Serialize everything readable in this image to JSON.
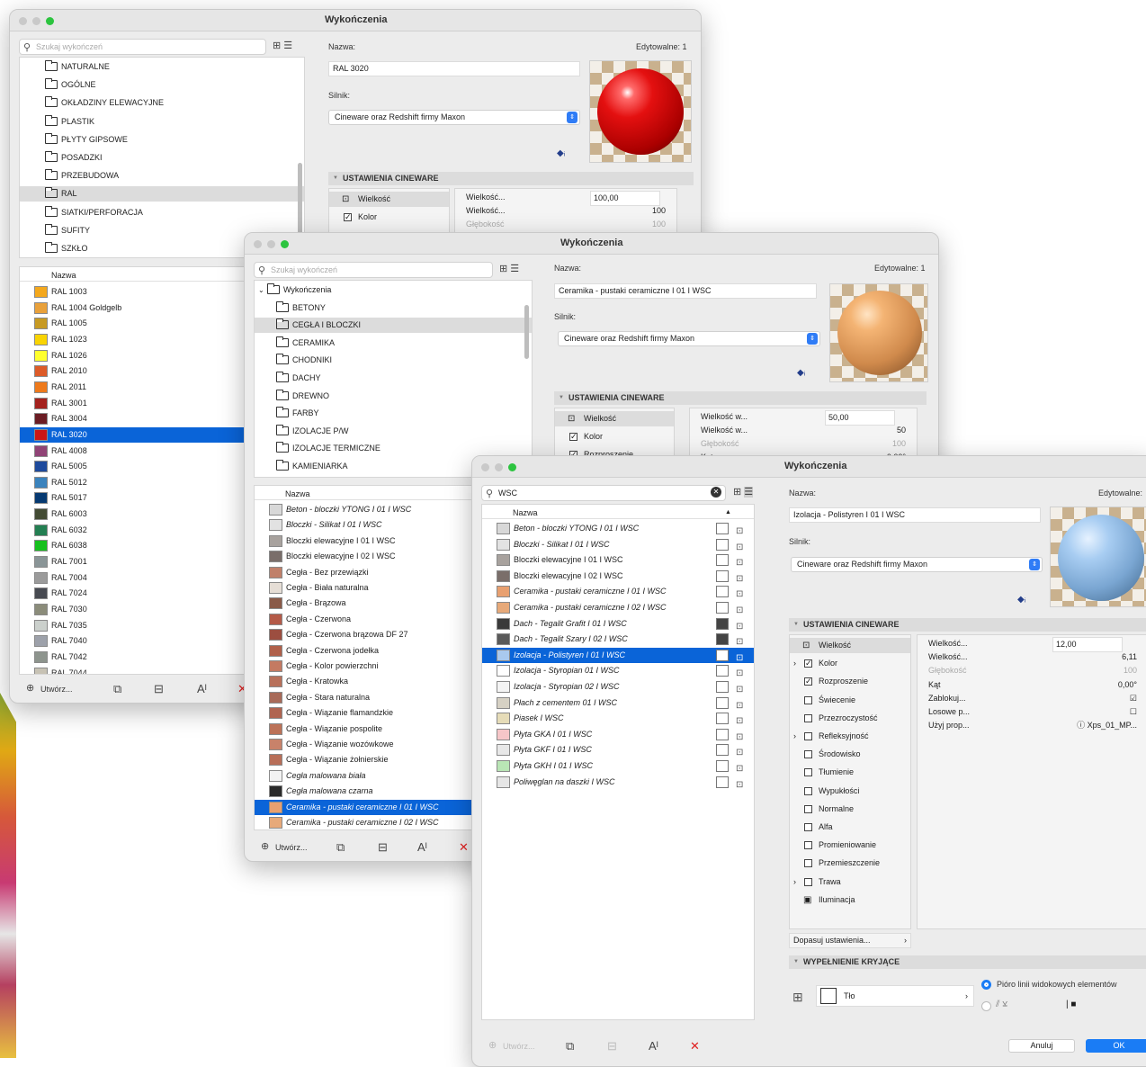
{
  "w1": {
    "title": "Wykończenia",
    "search_placeholder": "Szukaj wykończeń",
    "folders": [
      "NATURALNE",
      "OGÓLNE",
      "OKŁADZINY ELEWACYJNE",
      "PLASTIK",
      "PŁYTY GIPSOWE",
      "POSADZKI",
      "PRZEBUDOWA",
      "RAL",
      "SIATKI/PERFORACJA",
      "SUFITY",
      "SZKŁO"
    ],
    "selected_folder": 7,
    "list_header": "Nazwa",
    "items": [
      {
        "name": "RAL 1003",
        "color": "#f4a81d"
      },
      {
        "name": "RAL 1004 Goldgelb",
        "color": "#e9a13b"
      },
      {
        "name": "RAL 1005",
        "color": "#c79a23"
      },
      {
        "name": "RAL 1023",
        "color": "#f9d402"
      },
      {
        "name": "RAL 1026",
        "color": "#ffff2d"
      },
      {
        "name": "RAL 2010",
        "color": "#dd5b28"
      },
      {
        "name": "RAL 2011",
        "color": "#ee7a1c"
      },
      {
        "name": "RAL 3001",
        "color": "#a4221e"
      },
      {
        "name": "RAL 3004",
        "color": "#6b1c23"
      },
      {
        "name": "RAL 3020",
        "color": "#cc1616"
      },
      {
        "name": "RAL 4008",
        "color": "#904376"
      },
      {
        "name": "RAL 5005",
        "color": "#1e4a9c"
      },
      {
        "name": "RAL 5012",
        "color": "#3b83bd"
      },
      {
        "name": "RAL 5017",
        "color": "#063971"
      },
      {
        "name": "RAL 6003",
        "color": "#434b34"
      },
      {
        "name": "RAL 6032",
        "color": "#237f52"
      },
      {
        "name": "RAL 6038",
        "color": "#16c01e"
      },
      {
        "name": "RAL 7001",
        "color": "#8a9597"
      },
      {
        "name": "RAL 7004",
        "color": "#9b9b9b"
      },
      {
        "name": "RAL 7024",
        "color": "#474a51"
      },
      {
        "name": "RAL 7030",
        "color": "#8b8c7a"
      },
      {
        "name": "RAL 7035",
        "color": "#cbd0cc"
      },
      {
        "name": "RAL 7040",
        "color": "#9da1aa"
      },
      {
        "name": "RAL 7042",
        "color": "#8d948d"
      },
      {
        "name": "RAL 7044",
        "color": "#c7c2b4"
      }
    ],
    "selected_item": 9,
    "create_label": "Utwórz...",
    "name_label": "Nazwa:",
    "name_value": "RAL 3020",
    "editable": "Edytowalne: 1",
    "engine_label": "Silnik:",
    "engine_value": "Cineware oraz Redshift firmy Maxon",
    "section": "USTAWIENIA CINEWARE",
    "channels": [
      {
        "label": "Wielkość",
        "checked": false
      },
      {
        "label": "Kolor",
        "checked": true
      }
    ],
    "props": [
      {
        "k": "Wielkość...",
        "v": "100,00"
      },
      {
        "k": "Wielkość...",
        "v": "100"
      },
      {
        "k": "Głębokość",
        "v": "100"
      }
    ]
  },
  "w2": {
    "title": "Wykończenia",
    "search_placeholder": "Szukaj wykończeń",
    "root": "Wykończenia",
    "folders": [
      "BETONY",
      "CEGŁA I BLOCZKI",
      "CERAMIKA",
      "CHODNIKI",
      "DACHY",
      "DREWNO",
      "FARBY",
      "IZOLACJE P/W",
      "IZOLACJE TERMICZNE",
      "KAMIENIARKA"
    ],
    "selected_folder": 1,
    "list_header": "Nazwa",
    "items": [
      {
        "name": "Beton - bloczki YTONG I 01 I WSC",
        "color": "#d8d8d8",
        "it": true
      },
      {
        "name": "Bloczki - Silikat I 01 I WSC",
        "color": "#e2e2e2",
        "it": true
      },
      {
        "name": "Bloczki elewacyjne I 01 I WSC",
        "color": "#a8a29e",
        "it": false
      },
      {
        "name": "Bloczki elewacyjne I 02 I WSC",
        "color": "#7a6e6a",
        "it": false
      },
      {
        "name": "Cegła - Bez przewiązki",
        "color": "#c0806a",
        "it": false
      },
      {
        "name": "Cegła - Biała naturalna",
        "color": "#e6ded6",
        "it": false
      },
      {
        "name": "Cegła - Brązowa",
        "color": "#8a5a48",
        "it": false
      },
      {
        "name": "Cegła - Czerwona",
        "color": "#b45a48",
        "it": false
      },
      {
        "name": "Cegła - Czerwona brązowa DF 27",
        "color": "#9c4e40",
        "it": false
      },
      {
        "name": "Cegła - Czerwona jodełka",
        "color": "#b0604a",
        "it": false
      },
      {
        "name": "Cegła - Kolor powierzchni",
        "color": "#c47a62",
        "it": false
      },
      {
        "name": "Cegła - Kratowka",
        "color": "#b8705a",
        "it": false
      },
      {
        "name": "Cegła - Stara naturalna",
        "color": "#a86a58",
        "it": false
      },
      {
        "name": "Cegła - Wiązanie flamandzkie",
        "color": "#b06450",
        "it": false
      },
      {
        "name": "Cegła - Wiązanie pospolite",
        "color": "#bc7258",
        "it": false
      },
      {
        "name": "Cegła - Wiązanie wozówkowe",
        "color": "#c8826a",
        "it": false
      },
      {
        "name": "Cegła - Wiązanie żołnierskie",
        "color": "#b86e58",
        "it": false
      },
      {
        "name": "Cegła malowana biała",
        "color": "#f2f2f2",
        "it": true
      },
      {
        "name": "Cegła malowana czarna",
        "color": "#2a2a2a",
        "it": true
      },
      {
        "name": "Ceramika - pustaki ceramiczne I 01 I WSC",
        "color": "#e8a070",
        "it": true
      },
      {
        "name": "Ceramika - pustaki ceramiczne I 02 I WSC",
        "color": "#e7a979",
        "it": true
      }
    ],
    "selected_item": 19,
    "create_label": "Utwórz...",
    "name_label": "Nazwa:",
    "name_value": "Ceramika - pustaki ceramiczne I 01 I WSC",
    "editable": "Edytowalne: 1",
    "engine_label": "Silnik:",
    "engine_value": "Cineware oraz Redshift firmy Maxon",
    "section": "USTAWIENIA CINEWARE",
    "channels": [
      {
        "label": "Wielkość",
        "checked": false
      },
      {
        "label": "Kolor",
        "checked": true
      },
      {
        "label": "Rozproszenie",
        "checked": true
      }
    ],
    "props": [
      {
        "k": "Wielkość w...",
        "v": "50,00"
      },
      {
        "k": "Wielkość w...",
        "v": "50"
      },
      {
        "k": "Głębokość",
        "v": "100"
      },
      {
        "k": "Kąt",
        "v": "0,00°"
      }
    ]
  },
  "w3": {
    "title": "Wykończenia",
    "search_value": "WSC",
    "list_header": "Nazwa",
    "items": [
      {
        "name": "Beton - bloczki YTONG I 01 I WSC",
        "color": "#d8d8d8",
        "it": true,
        "dark": false
      },
      {
        "name": "Bloczki - Silikat I 01 I WSC",
        "color": "#e2e2e2",
        "it": true,
        "dark": false
      },
      {
        "name": "Bloczki elewacyjne I 01 I WSC",
        "color": "#a8a29e",
        "it": false,
        "dark": false
      },
      {
        "name": "Bloczki elewacyjne I 02 I WSC",
        "color": "#7a6e6a",
        "it": false,
        "dark": false
      },
      {
        "name": "Ceramika - pustaki ceramiczne I 01 I WSC",
        "color": "#e8a070",
        "it": true,
        "dark": false
      },
      {
        "name": "Ceramika - pustaki ceramiczne I 02 I WSC",
        "color": "#e7a979",
        "it": true,
        "dark": false
      },
      {
        "name": "Dach - Tegalit Grafit I 01 I WSC",
        "color": "#3a3a3a",
        "it": true,
        "dark": true
      },
      {
        "name": "Dach - Tegalit Szary I 02 I WSC",
        "color": "#5a5a5a",
        "it": true,
        "dark": true
      },
      {
        "name": "Izolacja - Polistyren I 01 I WSC",
        "color": "#a9c9ee",
        "it": true,
        "dark": false
      },
      {
        "name": "Izolacja - Styropian 01 I WSC",
        "color": "#ffffff",
        "it": true,
        "dark": false
      },
      {
        "name": "Izolacja - Styropian 02 I WSC",
        "color": "#f4f4f4",
        "it": true,
        "dark": false
      },
      {
        "name": "Płach z cementem 01 I WSC",
        "color": "#d6d1c4",
        "it": true,
        "dark": false
      },
      {
        "name": "Piasek I WSC",
        "color": "#e6dcb8",
        "it": true,
        "dark": false
      },
      {
        "name": "Płyta GKA I 01 I WSC",
        "color": "#f6c6c8",
        "it": true,
        "dark": false
      },
      {
        "name": "Płyta GKF I 01 I WSC",
        "color": "#e8e8e8",
        "it": true,
        "dark": false
      },
      {
        "name": "Płyta GKH I 01 I WSC",
        "color": "#b9e5b5",
        "it": true,
        "dark": false
      },
      {
        "name": "Poliwęglan na daszki I WSC",
        "color": "#e6e6e6",
        "it": true,
        "dark": false
      }
    ],
    "selected_item": 8,
    "create_label": "Utwórz...",
    "name_label": "Nazwa:",
    "name_value": "Izolacja - Polistyren I 01 I WSC",
    "editable": "Edytowalne:",
    "engine_label": "Silnik:",
    "engine_value": "Cineware oraz Redshift firmy Maxon",
    "section": "USTAWIENIA CINEWARE",
    "channels": [
      {
        "label": "Wielkość",
        "checked": false,
        "chev": false,
        "special": "size"
      },
      {
        "label": "Kolor",
        "checked": true,
        "chev": true
      },
      {
        "label": "Rozproszenie",
        "checked": true,
        "chev": false
      },
      {
        "label": "Świecenie",
        "checked": false,
        "chev": false
      },
      {
        "label": "Przezroczystość",
        "checked": false,
        "chev": false
      },
      {
        "label": "Refleksyjność",
        "checked": false,
        "chev": true
      },
      {
        "label": "Środowisko",
        "checked": false,
        "chev": false
      },
      {
        "label": "Tłumienie",
        "checked": false,
        "chev": false
      },
      {
        "label": "Wypukłości",
        "checked": false,
        "chev": false
      },
      {
        "label": "Normalne",
        "checked": false,
        "chev": false
      },
      {
        "label": "Alfa",
        "checked": false,
        "chev": false
      },
      {
        "label": "Promieniowanie",
        "checked": false,
        "chev": false
      },
      {
        "label": "Przemieszczenie",
        "checked": false,
        "chev": false
      },
      {
        "label": "Trawa",
        "checked": false,
        "chev": true
      },
      {
        "label": "Iluminacja",
        "checked": false,
        "chev": false,
        "special": "illum"
      }
    ],
    "props": [
      {
        "k": "Wielkość...",
        "v": "12,00"
      },
      {
        "k": "Wielkość...",
        "v": "6,11"
      },
      {
        "k": "Głębokość",
        "v": "100"
      },
      {
        "k": "Kąt",
        "v": "0,00°"
      },
      {
        "k": "Zablokuj...",
        "v": "☑"
      },
      {
        "k": "Losowe p...",
        "v": "☐"
      },
      {
        "k": "Użyj prop...",
        "v": "ⓘ Xps_01_MP..."
      }
    ],
    "adjust": "Dopasuj ustawienia...",
    "fill_section": "WYPEŁNIENIE KRYJĄCE",
    "fill_value": "Tło",
    "radio1": "Pióro linii widokowych elementów",
    "cancel": "Anuluj",
    "ok": "OK"
  }
}
